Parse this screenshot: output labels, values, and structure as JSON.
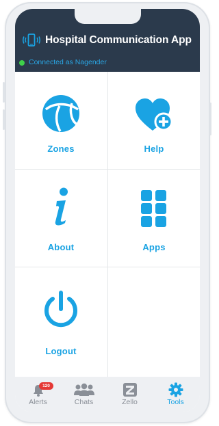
{
  "app": {
    "title": "Hospital Communication App",
    "status_text": "Connected as Nagender"
  },
  "tiles": [
    {
      "label": "Zones",
      "icon": "zones-icon"
    },
    {
      "label": "Help",
      "icon": "heart-plus-icon"
    },
    {
      "label": "About",
      "icon": "info-icon"
    },
    {
      "label": "Apps",
      "icon": "apps-grid-icon"
    },
    {
      "label": "Logout",
      "icon": "power-icon"
    }
  ],
  "tabbar": {
    "items": [
      {
        "label": "Alerts",
        "icon": "bell-icon",
        "badge": "120"
      },
      {
        "label": "Chats",
        "icon": "people-icon"
      },
      {
        "label": "Zello",
        "icon": "zello-icon"
      },
      {
        "label": "Tools",
        "icon": "gear-icon",
        "active": true
      }
    ]
  },
  "colors": {
    "header_bg": "#2b3a4c",
    "accent": "#1aa3e3",
    "status_online": "#3fd14a",
    "badge": "#e53935"
  }
}
